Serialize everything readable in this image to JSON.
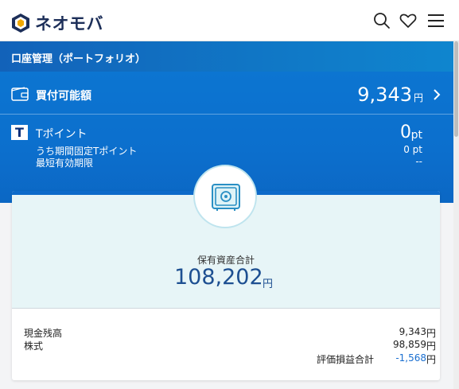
{
  "app": {
    "brand": "ネオモバ"
  },
  "header": {
    "icons": [
      "search-icon",
      "heart-icon",
      "menu-icon"
    ]
  },
  "page": {
    "title": "口座管理（ポートフォリオ）"
  },
  "buying_power": {
    "label": "買付可能額",
    "value": "9,343",
    "unit": "円"
  },
  "tpoint": {
    "label": "Tポイント",
    "logo_letter": "T",
    "value": "0",
    "unit": "pt",
    "limited_label": "うち期間固定Tポイント",
    "limited_value": "0 pt",
    "expiry_label": "最短有効期限",
    "expiry_value": "--"
  },
  "assets": {
    "total_label": "保有資産合計",
    "total_value": "108,202",
    "total_unit": "円",
    "rows": [
      {
        "label": "現金残高",
        "value": "9,343",
        "unit": "円"
      },
      {
        "label": "株式",
        "value": "98,859",
        "unit": "円"
      }
    ],
    "pl_label": "評価損益合計",
    "pl_value": "-1,568",
    "pl_unit": "円"
  },
  "colors": {
    "brand_navy": "#1d2f59",
    "primary_blue": "#0c75d1",
    "negative_blue": "#1a6fd0",
    "card_tint": "#e7f5f7"
  }
}
